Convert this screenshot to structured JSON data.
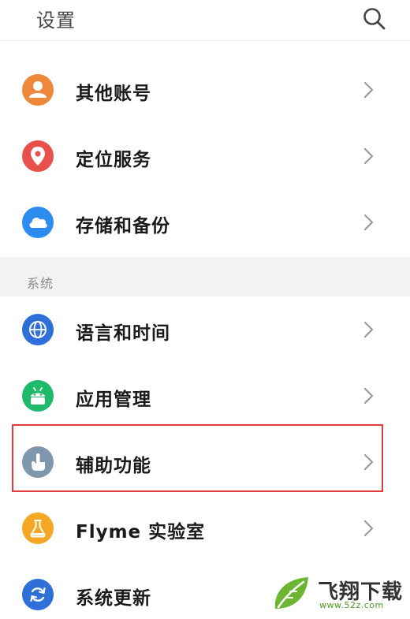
{
  "header": {
    "title": "设置",
    "search_icon": "search-icon"
  },
  "items_top": [
    {
      "label": "其他账号",
      "icon": "person-icon",
      "color": "#f0883b"
    },
    {
      "label": "定位服务",
      "icon": "location-pin-icon",
      "color": "#e8504a"
    },
    {
      "label": "存储和备份",
      "icon": "cloud-icon",
      "color": "#2d8cf0"
    }
  ],
  "section": {
    "label": "系统"
  },
  "items_system": [
    {
      "label": "语言和时间",
      "icon": "globe-icon",
      "color": "#2e6fd8"
    },
    {
      "label": "应用管理",
      "icon": "android-icon",
      "color": "#1fba6a"
    },
    {
      "label": "辅助功能",
      "icon": "hand-pointer-icon",
      "color": "#7f97ad"
    },
    {
      "label": "Flyme 实验室",
      "icon": "flask-icon",
      "color": "#f5a623"
    },
    {
      "label": "系统更新",
      "icon": "refresh-icon",
      "color": "#2e6fd8"
    }
  ],
  "highlight_color": "#e23b3b",
  "watermark": {
    "main": "飞翔下载",
    "sub": "www.52z.com"
  }
}
